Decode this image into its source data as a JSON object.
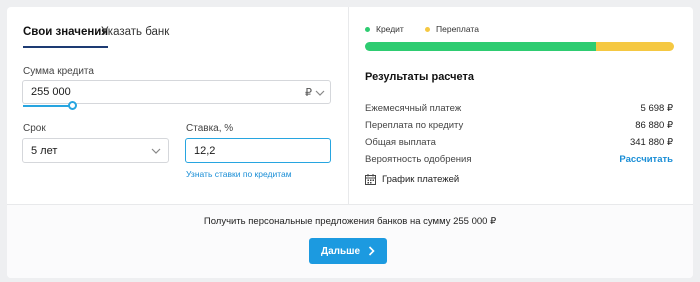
{
  "tabs": [
    {
      "label": "Свои значения",
      "active": true
    },
    {
      "label": "Указать банк",
      "active": false
    }
  ],
  "amount": {
    "label": "Сумма кредита",
    "value": "255 000",
    "currency": "₽",
    "slider_fraction": 0.16
  },
  "term": {
    "label": "Срок",
    "value": "5 лет"
  },
  "rate": {
    "label": "Ставка, %",
    "value": "12,2",
    "link": "Узнать ставки по кредитам"
  },
  "legend": {
    "credit": {
      "label": "Кредит",
      "color": "#2ecc71"
    },
    "overpay": {
      "label": "Переплата",
      "color": "#f5c842"
    }
  },
  "bar": {
    "credit_fraction": 0.746,
    "overpay_fraction": 0.254
  },
  "results": {
    "title": "Результаты расчета",
    "rows": [
      {
        "label": "Ежемесячный платеж",
        "value": "5 698 ₽"
      },
      {
        "label": "Переплата по кредиту",
        "value": "86 880 ₽"
      },
      {
        "label": "Общая выплата",
        "value": "341 880 ₽"
      },
      {
        "label": "Вероятность одобрения",
        "value": "Рассчитать"
      }
    ],
    "schedule": "График платежей"
  },
  "bottom": {
    "offer_text": "Получить персональные предложения банков на сумму 255 000 ₽",
    "button": "Дальше"
  },
  "colors": {
    "accent": "#1c9ae0",
    "link": "#1a8ed6",
    "tab_underline": "#1d3b73"
  }
}
